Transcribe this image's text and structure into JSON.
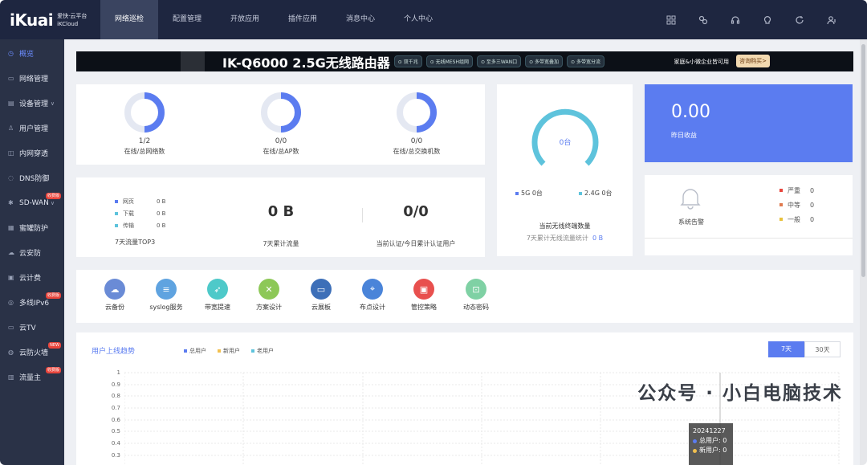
{
  "header": {
    "brand": "iKuai",
    "brand_sub_1": "爱快·云平台",
    "brand_sub_2": "iKCloud",
    "nav": [
      {
        "label": "网络巡检",
        "active": true
      },
      {
        "label": "配置管理"
      },
      {
        "label": "开放应用"
      },
      {
        "label": "插件应用"
      },
      {
        "label": "消息中心"
      },
      {
        "label": "个人中心"
      }
    ],
    "tools": [
      "grid-icon",
      "link-icon",
      "headset-icon",
      "bulb-icon",
      "refresh-icon",
      "user-list-icon"
    ]
  },
  "sidebar": {
    "items": [
      {
        "label": "概览",
        "icon": "clock-icon",
        "active": true
      },
      {
        "label": "网络管理",
        "icon": "monitor-icon"
      },
      {
        "label": "设备管理",
        "icon": "device-icon",
        "arrow": "∨"
      },
      {
        "label": "用户管理",
        "icon": "user-icon"
      },
      {
        "label": "内网穿透",
        "icon": "tunnel-icon"
      },
      {
        "label": "DNS防御",
        "icon": "shield-icon"
      },
      {
        "label": "SD-WAN",
        "icon": "sdwan-icon",
        "arrow": "∨",
        "badge": "收费版"
      },
      {
        "label": "蜜罐防护",
        "icon": "honeypot-icon"
      },
      {
        "label": "云安防",
        "icon": "cloud-security-icon"
      },
      {
        "label": "云计费",
        "icon": "billing-icon"
      },
      {
        "label": "多线IPv6",
        "icon": "ipv6-icon",
        "badge": "收费版"
      },
      {
        "label": "云TV",
        "icon": "tv-icon"
      },
      {
        "label": "云防火墙",
        "icon": "firewall-icon",
        "badge": "NEW"
      },
      {
        "label": "流量主",
        "icon": "traffic-icon",
        "badge": "收费版"
      }
    ]
  },
  "banner": {
    "title": "IK-Q6000 2.5G无线路由器",
    "features": [
      "⊙ 双千兆",
      "⊙ 无线MESH组网",
      "⊙ 至多三WAN口",
      "⊙ 多带宽叠加",
      "⊙ 多带宽分流"
    ],
    "right_text": "家庭&小微企业皆可用",
    "buy_label": "咨询购买>"
  },
  "stats": [
    {
      "value": "1/2",
      "label": "在线/总网络数",
      "online_fraction": 0.5
    },
    {
      "value": "0/0",
      "label": "在线/总AP数",
      "online_fraction": 0
    },
    {
      "value": "0/0",
      "label": "在线/总交换机数",
      "online_fraction": 0
    }
  ],
  "traffic": {
    "legend": [
      {
        "name": "网页",
        "value": "0 B",
        "color": "#5b7cf0"
      },
      {
        "name": "下载",
        "value": "0 B",
        "color": "#5ec3dc"
      },
      {
        "name": "传输",
        "value": "0 B",
        "color": "#5ec3dc"
      }
    ],
    "top3_label": "7天流量TOP3",
    "total_value": "0 B",
    "total_label": "7天累计流量",
    "auth_value": "0/0",
    "auth_label": "当前认证/今日累计认证用户"
  },
  "wireless": {
    "ring_value": "0台",
    "band_5g": "5G  0台",
    "band_24g": "2.4G  0台",
    "title": "当前无线终端数量",
    "sub_label": "7天累计无线流量统计",
    "sub_value": "0 B",
    "colors": {
      "5g": "#5b7cf0",
      "24g": "#5ec3dc"
    }
  },
  "income": {
    "value": "0.00",
    "label": "昨日收益"
  },
  "alarm": {
    "label": "系统告警",
    "levels": [
      {
        "name": "严重",
        "value": "0",
        "color": "#e8453c"
      },
      {
        "name": "中等",
        "value": "0",
        "color": "#e07a4e"
      },
      {
        "name": "一般",
        "value": "0",
        "color": "#e8c13c"
      }
    ]
  },
  "apps": [
    {
      "label": "云备份",
      "icon": "cloud-backup-icon",
      "color": "#6a8bd6"
    },
    {
      "label": "syslog服务",
      "icon": "syslog-icon",
      "color": "#5fa3e0"
    },
    {
      "label": "带宽提速",
      "icon": "rocket-icon",
      "color": "#4ec9c9"
    },
    {
      "label": "方案设计",
      "icon": "design-icon",
      "color": "#8dc857"
    },
    {
      "label": "云展板",
      "icon": "board-icon",
      "color": "#3d6fb8"
    },
    {
      "label": "布点设计",
      "icon": "pin-icon",
      "color": "#4a84d9"
    },
    {
      "label": "管控策略",
      "icon": "policy-icon",
      "color": "#e8504e"
    },
    {
      "label": "动态密码",
      "icon": "lock-icon",
      "color": "#7fd1a4"
    }
  ],
  "trend": {
    "title": "用户上线趋势",
    "tabs": [
      {
        "label": "7天",
        "active": true
      },
      {
        "label": "30天"
      }
    ],
    "legend": [
      {
        "name": "总用户",
        "color": "#5b7cf0"
      },
      {
        "name": "新用户",
        "color": "#f2c04e"
      },
      {
        "name": "老用户",
        "color": "#5ec3dc"
      }
    ],
    "y_ticks": [
      "1",
      "0.9",
      "0.8",
      "0.7",
      "0.6",
      "0.5",
      "0.4",
      "0.3"
    ],
    "tooltip": {
      "date": "20241227",
      "total": "总用户: 0",
      "new": "新用户: 0"
    }
  },
  "watermark": "公众号 · 小白电脑技术"
}
